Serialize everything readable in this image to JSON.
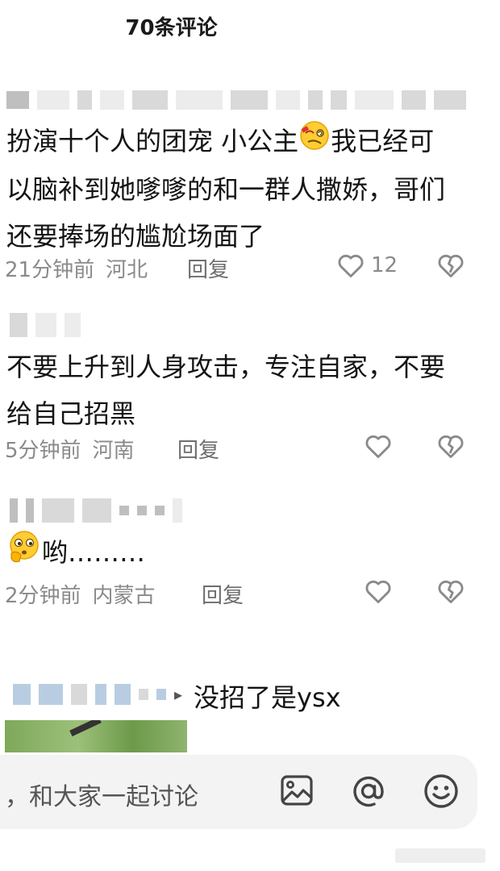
{
  "header": {
    "title": "70条评论"
  },
  "comments": [
    {
      "text_before_emoji": "扮演十个人的团宠 小公主",
      "text_after_emoji": "我已经可",
      "text_line2": "以脑补到她嗲嗲的和一群人撒娇，哥们",
      "text_line3": "还要捧场的尴尬场面了",
      "time": "21分钟前",
      "location": "河北",
      "reply_label": "回复",
      "likes": "12"
    },
    {
      "text_line1": "不要上升到人身攻击，专注自家，不要",
      "text_line2": "给自己招黑",
      "time": "5分钟前",
      "location": "河南",
      "reply_label": "回复"
    },
    {
      "text": "哟………",
      "time": "2分钟前",
      "location": "内蒙古",
      "reply_label": "回复"
    }
  ],
  "reply_preview": {
    "text": "没招了是ysx"
  },
  "input_bar": {
    "placeholder": "，和大家一起讨论",
    "icons": [
      "image-icon",
      "at-icon",
      "emoji-icon"
    ]
  },
  "colors": {
    "text": "#141414",
    "meta": "#8a8a8a",
    "input_bg": "#f3f3f3"
  }
}
